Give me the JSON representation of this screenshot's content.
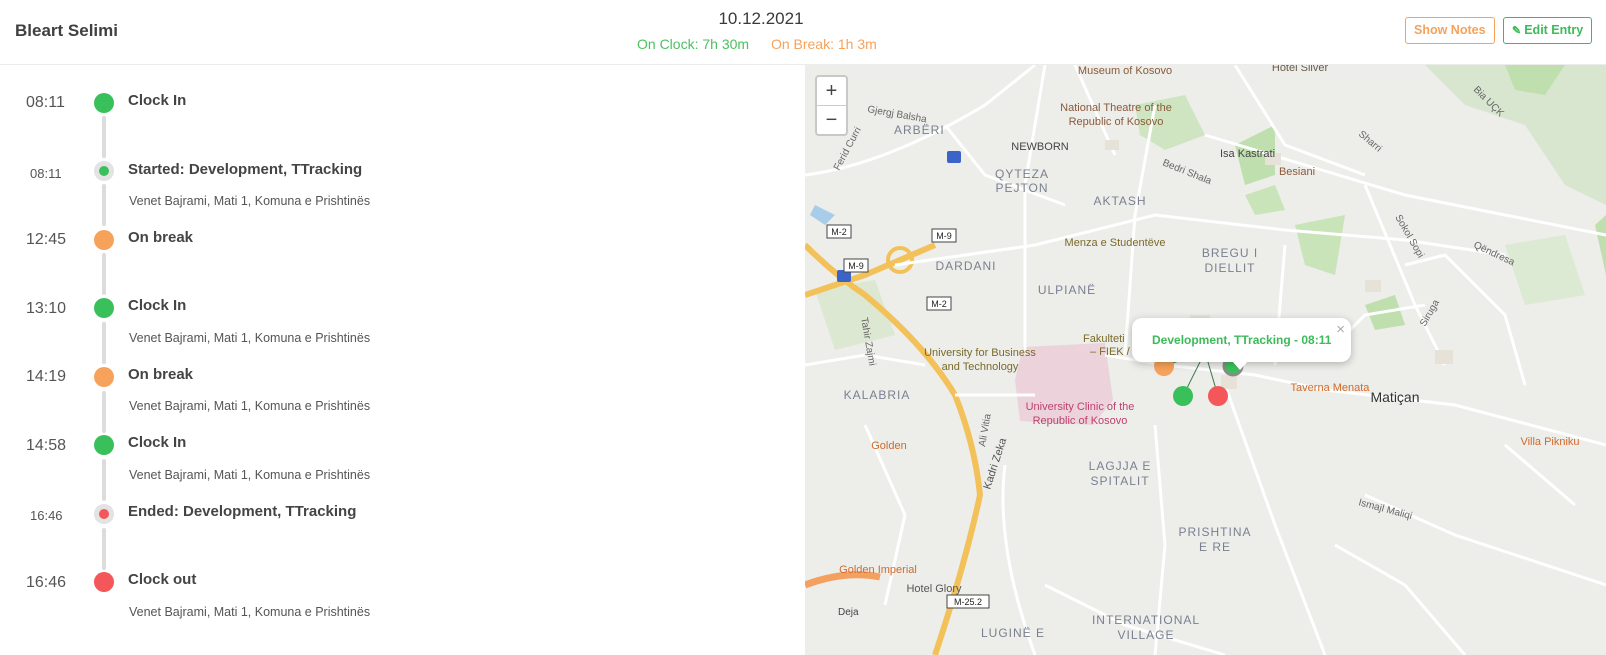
{
  "header": {
    "user_name": "Bleart Selimi",
    "date": "10.12.2021",
    "on_clock": "On Clock: 7h 30m",
    "on_break": "On Break: 1h 3m",
    "show_notes_label": "Show Notes",
    "edit_entry_label": "Edit Entry"
  },
  "timeline": [
    {
      "time": "08:11",
      "title": "Clock In",
      "address": "",
      "type": "clock-in"
    },
    {
      "time": "08:11",
      "title": "Started: Development, TTracking",
      "address": "Venet Bajrami, Mati 1, Komuna e Prishtinës",
      "type": "task-start"
    },
    {
      "time": "12:45",
      "title": "On break",
      "address": "",
      "type": "break"
    },
    {
      "time": "13:10",
      "title": "Clock In",
      "address": "Venet Bajrami, Mati 1, Komuna e Prishtinës",
      "type": "clock-in"
    },
    {
      "time": "14:19",
      "title": "On break",
      "address": "Venet Bajrami, Mati 1, Komuna e Prishtinës",
      "type": "break"
    },
    {
      "time": "14:58",
      "title": "Clock In",
      "address": "Venet Bajrami, Mati 1, Komuna e Prishtinës",
      "type": "clock-in"
    },
    {
      "time": "16:46",
      "title": "Ended: Development, TTracking",
      "address": "",
      "type": "task-end"
    },
    {
      "time": "16:46",
      "title": "Clock out",
      "address": "Venet Bajrami, Mati 1, Komuna e Prishtinës",
      "type": "clock-out"
    }
  ],
  "map": {
    "zoom_in": "+",
    "zoom_out": "−",
    "popup_text": "Development, TTracking - 08:11",
    "popup_close": "×",
    "labels": {
      "museum": "Museum of Kosovo",
      "hotel_silver": "Hotel Silver",
      "bia_uck": "Bia UÇK",
      "gjergj": "Gjergj Balsha",
      "arberi": "ARBËRI",
      "theatre1": "National Theatre of the",
      "theatre2": "Republic of Kosovo",
      "ferid": "Ferid Curri",
      "newborn": "NEWBORN",
      "isa": "Isa Kastrati",
      "sharri": "Sharri",
      "bedri": "Bedri Shala",
      "besiani": "Besiani",
      "qyteza1": "QYTEZA",
      "qyteza2": "PEJTON",
      "aktash": "AKTASH",
      "m2a": "M-2",
      "m9a": "M-9",
      "m9b": "M-9",
      "m2b": "M-2",
      "m252": "M-25.2",
      "menza": "Menza e Studentëve",
      "sokol": "Sokol Sopi",
      "qendresa": "Qëndresa",
      "dardani": "DARDANI",
      "bregu1": "BREGU I",
      "bregu2": "DIELLIT",
      "ulpiane": "ULPIANË",
      "siruga": "Siruga",
      "tahir": "Tahir Zajmi",
      "univ1": "University for Business",
      "univ2": "and Technology",
      "fak1": "Fakulteti",
      "fak2": "– FIEK / Fakulte",
      "taverna": "Taverna Menata",
      "matican": "Matiçan",
      "kalabria": "KALABRIA",
      "clinic1": "University Clinic of the",
      "clinic2": "Republic of Kosovo",
      "golden": "Golden",
      "ali": "Ali Vitia",
      "villa": "Villa Pikniku",
      "lagjja1": "LAGJJA E",
      "lagjja2": "SPITALIT",
      "kadri": "Kadri Zeka",
      "ismajl": "Ismajl Maliqi",
      "prishtina1": "PRISHTINA",
      "prishtina2": "E RE",
      "golden_imp": "Golden Imperial",
      "hotel_glory": "Hotel Glory",
      "deja": "Deja",
      "lugine": "LUGINË E",
      "intl1": "INTERNATIONAL",
      "intl2": "VILLAGE"
    }
  }
}
